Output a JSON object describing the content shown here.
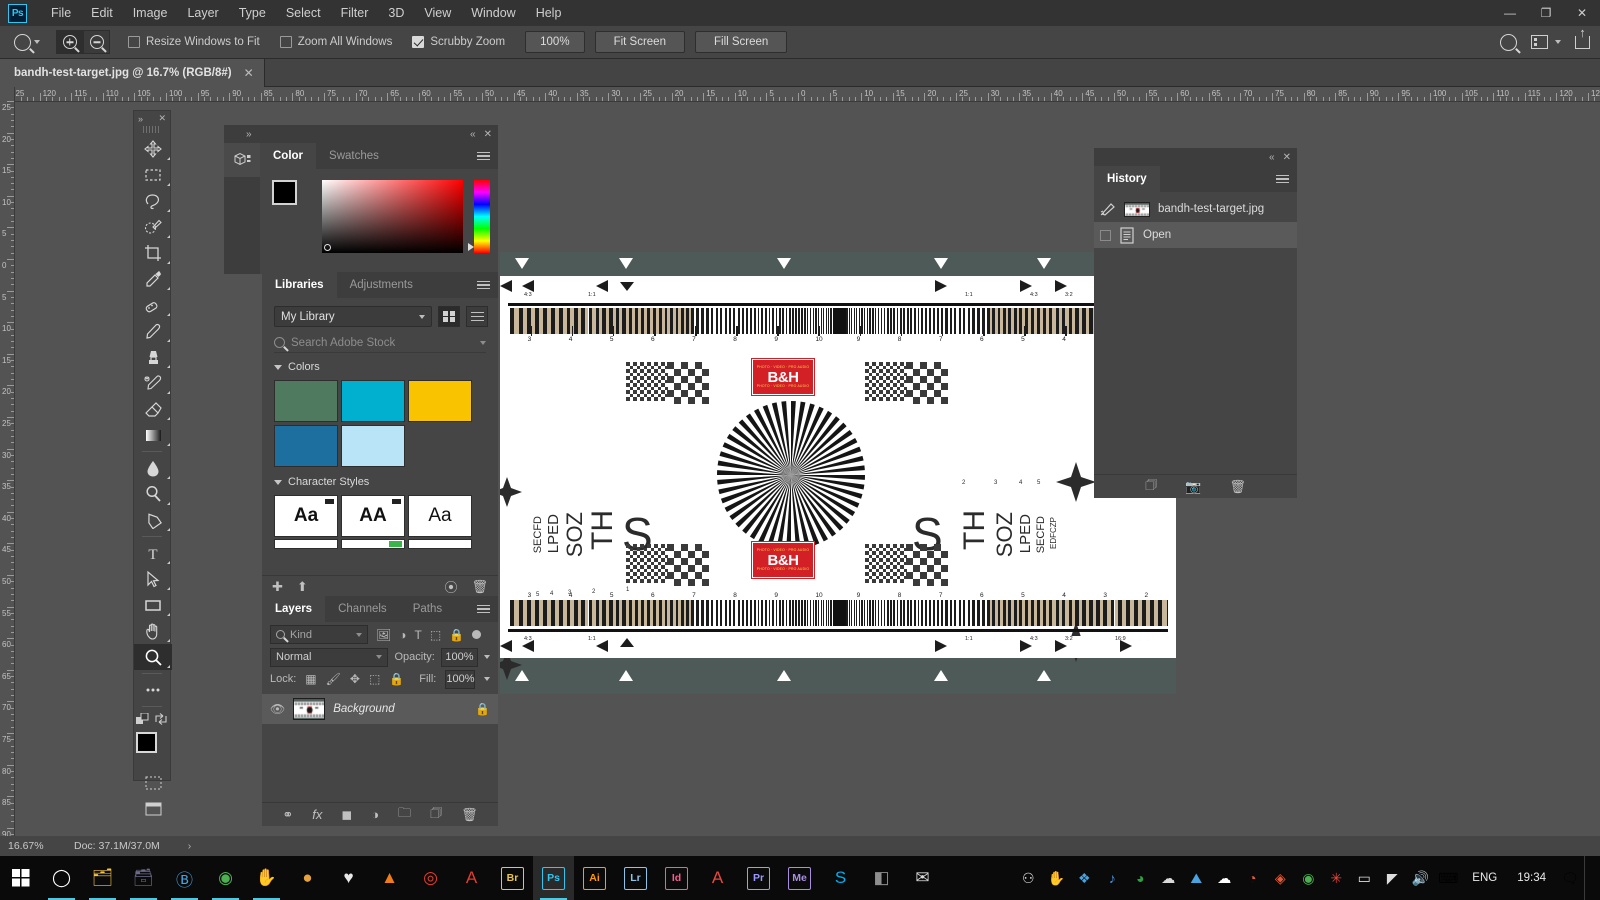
{
  "app": {
    "name": "Adobe Photoshop",
    "logo_text": "Ps"
  },
  "menubar": {
    "items": [
      "File",
      "Edit",
      "Image",
      "Layer",
      "Type",
      "Select",
      "Filter",
      "3D",
      "View",
      "Window",
      "Help"
    ]
  },
  "window_controls": {
    "minimize": "—",
    "maximize": "❐",
    "close": "✕"
  },
  "options_bar": {
    "tool": "zoom-tool",
    "zoom_in_label": "Zoom In",
    "zoom_out_label": "Zoom Out",
    "resize_windows_label": "Resize Windows to Fit",
    "resize_windows_checked": false,
    "zoom_all_label": "Zoom All Windows",
    "zoom_all_checked": false,
    "scrubby_label": "Scrubby Zoom",
    "scrubby_checked": true,
    "percent_button": "100%",
    "fit_screen_button": "Fit Screen",
    "fill_screen_button": "Fill Screen",
    "right_icons": [
      "search-icon",
      "workspace-icon",
      "share-icon"
    ]
  },
  "document_tab": {
    "title": "bandh-test-target.jpg @ 16.7% (RGB/8#)",
    "close": "✕"
  },
  "rulers": {
    "unit": "cm",
    "horizontal_labels": [
      "30",
      "25",
      "20",
      "15",
      "10",
      "5",
      "0",
      "5",
      "10",
      "15",
      "20",
      "25",
      "30",
      "35",
      "40",
      "45",
      "50",
      "55",
      "60",
      "65",
      "70",
      "75",
      "80",
      "85",
      "90",
      "95"
    ],
    "vertical_labels": [
      "10",
      "5",
      "0",
      "5",
      "10",
      "15",
      "20",
      "25",
      "30",
      "35",
      "40",
      "45"
    ]
  },
  "toolbar": {
    "collapse_icon": "»",
    "close_icon": "✕",
    "tools": [
      {
        "name": "move-tool",
        "glyph": "move"
      },
      {
        "name": "marquee-tool",
        "glyph": "marquee"
      },
      {
        "name": "lasso-tool",
        "glyph": "lasso"
      },
      {
        "name": "quick-selection-tool",
        "glyph": "quickselect"
      },
      {
        "name": "crop-tool",
        "glyph": "crop"
      },
      {
        "name": "eyedropper-tool",
        "glyph": "eyedropper"
      },
      {
        "name": "spot-healing-brush-tool",
        "glyph": "healing"
      },
      {
        "name": "brush-tool",
        "glyph": "brush"
      },
      {
        "name": "clone-stamp-tool",
        "glyph": "stamp"
      },
      {
        "name": "history-brush-tool",
        "glyph": "historybrush"
      },
      {
        "name": "eraser-tool",
        "glyph": "eraser"
      },
      {
        "name": "gradient-tool",
        "glyph": "gradient"
      },
      {
        "name": "blur-tool",
        "glyph": "blur"
      },
      {
        "name": "dodge-tool",
        "glyph": "dodge"
      },
      {
        "name": "pen-tool",
        "glyph": "pen"
      },
      {
        "name": "type-tool",
        "glyph": "T"
      },
      {
        "name": "path-selection-tool",
        "glyph": "arrow"
      },
      {
        "name": "rectangle-tool",
        "glyph": "rect"
      },
      {
        "name": "hand-tool",
        "glyph": "hand"
      },
      {
        "name": "zoom-tool",
        "glyph": "zoom",
        "active": true
      },
      {
        "name": "edit-toolbar-button",
        "glyph": "dots"
      }
    ],
    "foreground_color": "#000000",
    "background_color": "#ffffff"
  },
  "color_panel": {
    "tabs": [
      {
        "label": "Color",
        "active": true
      },
      {
        "label": "Swatches",
        "active": false
      }
    ],
    "foreground": "#000000",
    "background": "#ffffff",
    "ramp": "red-spectrum"
  },
  "libraries_panel": {
    "tabs": [
      {
        "label": "Libraries",
        "active": true
      },
      {
        "label": "Adjustments",
        "active": false
      }
    ],
    "library_select": "My Library",
    "search_placeholder": "Search Adobe Stock",
    "sections": [
      {
        "title": "Colors",
        "swatches": [
          "#507a60",
          "#00b0ce",
          "#fac300",
          "#1d6fa0",
          "#b9e3f7"
        ]
      },
      {
        "title": "Character Styles",
        "items": [
          {
            "label": "Aa",
            "bold": true,
            "badge": true
          },
          {
            "label": "AA",
            "bold": true,
            "badge": true
          },
          {
            "label": "Aa",
            "bold": false,
            "badge": false
          }
        ]
      }
    ],
    "footer_icons": [
      "add-icon",
      "upload-icon",
      "link-icon",
      "delete-icon"
    ]
  },
  "layers_panel": {
    "tabs": [
      {
        "label": "Layers",
        "active": true
      },
      {
        "label": "Channels",
        "active": false
      },
      {
        "label": "Paths",
        "active": false
      }
    ],
    "filter_label": "Kind",
    "filter_icons": [
      "image-filter-icon",
      "adjustment-filter-icon",
      "type-filter-icon",
      "shape-filter-icon",
      "smartobject-filter-icon"
    ],
    "blend_mode": "Normal",
    "opacity_label": "Opacity:",
    "opacity_value": "100%",
    "lock_label": "Lock:",
    "lock_icons": [
      "lock-transparency-icon",
      "lock-image-icon",
      "lock-position-icon",
      "lock-artboard-icon",
      "lock-all-icon"
    ],
    "fill_label": "Fill:",
    "fill_value": "100%",
    "layers": [
      {
        "name": "Background",
        "visible": true,
        "locked": true,
        "selected": true
      }
    ],
    "footer_icons": [
      "link-layers-icon",
      "layer-styles-icon",
      "layer-mask-icon",
      "adjustment-layer-icon",
      "new-group-icon",
      "new-layer-icon",
      "delete-layer-icon"
    ]
  },
  "history_panel": {
    "collapse_icon": "«",
    "close_icon": "✕",
    "tabs": [
      {
        "label": "History",
        "active": true
      }
    ],
    "snapshot": "bandh-test-target.jpg",
    "states": [
      {
        "label": "Open",
        "selected": true
      }
    ],
    "footer_icons": [
      "create-document-icon",
      "create-snapshot-icon",
      "delete-icon"
    ]
  },
  "status_bar": {
    "zoom": "16.67%",
    "doc_info": "Doc: 37.1M/37.0M",
    "arrow": "›"
  },
  "canvas": {
    "document_name": "bandh-test-target.jpg",
    "target_type": "B&H resolution test chart",
    "logo_text": "B&H",
    "logo_tagline_top": "PHOTO · VIDEO · PRO AUDIO",
    "logo_tagline_bottom": "PHOTO · VIDEO · PRO AUDIO",
    "aspect_ratio_marks": [
      "4:3",
      "1:1",
      "1:1",
      "4:3",
      "3:2",
      "16:9"
    ],
    "frequency_scale": [
      "3",
      "4",
      "5",
      "6",
      "7",
      "8",
      "9",
      "10",
      "9",
      "8",
      "7",
      "6",
      "5",
      "4",
      "3",
      "2"
    ],
    "eye_chart_rows": [
      "S",
      "TH",
      "SOZ",
      "LPED",
      "SECFD"
    ],
    "eye_chart_sizes": [
      "1",
      "2",
      "3",
      "4",
      "5"
    ]
  },
  "taskbar": {
    "start_icon": "windows-icon",
    "apps": [
      {
        "name": "cortana-icon",
        "glyph": "◯",
        "color": "#ffffff"
      },
      {
        "name": "file-explorer-icon",
        "glyph": "🗂",
        "color": "#f6c445"
      },
      {
        "name": "store-icon",
        "glyph": "🗃",
        "color": "#6a6a8a"
      },
      {
        "name": "bitdefender-icon",
        "glyph": "Ⓑ",
        "color": "#4aa3df"
      },
      {
        "name": "chrome-icon",
        "glyph": "◉",
        "color": "#4caf50"
      },
      {
        "name": "handbrake-icon",
        "glyph": "✋",
        "color": "#e8a33d"
      },
      {
        "name": "app-icon",
        "glyph": "●",
        "color": "#e6a23c"
      },
      {
        "name": "thunderbird-icon",
        "glyph": "♥",
        "color": "#e8e8e8"
      },
      {
        "name": "vlc-icon",
        "glyph": "▲",
        "color": "#ef7c1b"
      },
      {
        "name": "opera-icon",
        "glyph": "◎",
        "color": "#e63c2f"
      },
      {
        "name": "acrobat-icon",
        "glyph": "A",
        "color": "#e33b2e"
      },
      {
        "name": "bridge-icon",
        "glyph": "Br",
        "color": "#e8c44d"
      },
      {
        "name": "photoshop-icon",
        "glyph": "Ps",
        "color": "#31c5f0"
      },
      {
        "name": "illustrator-icon",
        "glyph": "Ai",
        "color": "#ff9a00"
      },
      {
        "name": "lightroom-icon",
        "glyph": "Lr",
        "color": "#8cc3e8"
      },
      {
        "name": "indesign-icon",
        "glyph": "Id",
        "color": "#f95b8d"
      },
      {
        "name": "animate-icon",
        "glyph": "A",
        "color": "#e8483f"
      },
      {
        "name": "premiere-icon",
        "glyph": "Pr",
        "color": "#9999ff"
      },
      {
        "name": "media-encoder-icon",
        "glyph": "Me",
        "color": "#a98ee0"
      },
      {
        "name": "skype-icon",
        "glyph": "S",
        "color": "#00aff0"
      },
      {
        "name": "app-icon-2",
        "glyph": "◧",
        "color": "#8e8e8e"
      },
      {
        "name": "mail-icon",
        "glyph": "✉",
        "color": "#d9d9d9"
      }
    ],
    "tray": [
      {
        "name": "people-icon",
        "glyph": "⚇",
        "color": "#dddddd"
      },
      {
        "name": "handbrake-tray-icon",
        "glyph": "✋",
        "color": "#e8a33d"
      },
      {
        "name": "dropbox-icon",
        "glyph": "❖",
        "color": "#4aa3df"
      },
      {
        "name": "audio-driver-icon",
        "glyph": "♪",
        "color": "#4a90d9"
      },
      {
        "name": "security-icon",
        "glyph": "◕",
        "color": "#2f9e44"
      },
      {
        "name": "onedrive-icon",
        "glyph": "☁",
        "color": "#d9d9d9"
      },
      {
        "name": "photos-icon",
        "glyph": "⛰",
        "color": "#4aa3df"
      },
      {
        "name": "cloud-icon",
        "glyph": "☁",
        "color": "#ffffff"
      },
      {
        "name": "graphics-icon",
        "glyph": "◔",
        "color": "#e05c3e"
      },
      {
        "name": "creative-cloud-icon",
        "glyph": "◈",
        "color": "#e05c3e"
      },
      {
        "name": "chrome-tray-icon",
        "glyph": "◉",
        "color": "#4caf50"
      },
      {
        "name": "nvidia-icon",
        "glyph": "✳",
        "color": "#e8453c"
      },
      {
        "name": "battery-icon",
        "glyph": "▭",
        "color": "#dddddd"
      },
      {
        "name": "wifi-icon",
        "glyph": "◤",
        "color": "#dddddd"
      },
      {
        "name": "volume-icon",
        "glyph": "🔊",
        "color": "#dddddd"
      }
    ],
    "keyboard_icon": "⌨",
    "language": "ENG",
    "clock": "19:34",
    "action_center_icon": "notification-icon"
  }
}
